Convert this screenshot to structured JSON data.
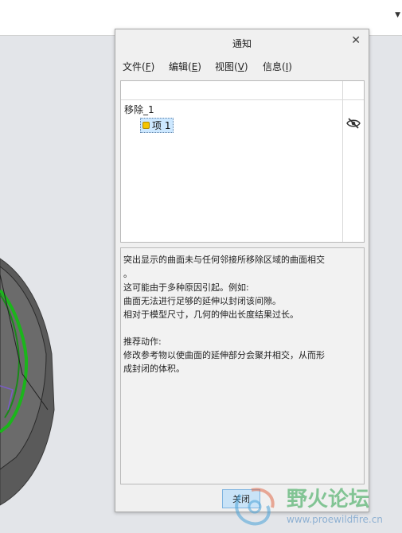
{
  "dialog": {
    "title": "通知",
    "close_icon": "close-icon",
    "menu": [
      {
        "label": "文件(",
        "key": "F",
        "end": ")"
      },
      {
        "label": "编辑(",
        "key": "E",
        "end": ")"
      },
      {
        "label": "视图(",
        "key": "V",
        "end": ")"
      },
      {
        "label": "信息(",
        "key": "I",
        "end": ")"
      }
    ],
    "tree": {
      "parent": "移除_1",
      "child": "项 1",
      "child_icon": "warning-dot-icon",
      "visibility_icon": "eye-hidden-icon"
    },
    "message": {
      "lines": [
        "突出显示的曲面未与任何邻接所移除区域的曲面相交",
        "。",
        "这可能由于多种原因引起。例如:",
        "曲面无法进行足够的延伸以封闭该间隙。",
        "相对于模型尺寸，几何的伸出长度结果过长。",
        "",
        "推荐动作:",
        "修改参考物以使曲面的延伸部分会聚并相交，从而形",
        "成封闭的体积。"
      ]
    },
    "close_button": "关闭"
  },
  "watermark": {
    "title": "野火论坛",
    "url": "www.proewildfire.cn"
  },
  "colors": {
    "accent_green": "#1bb51b",
    "selection": "#cde8ff",
    "button": "#c9e3f7"
  }
}
